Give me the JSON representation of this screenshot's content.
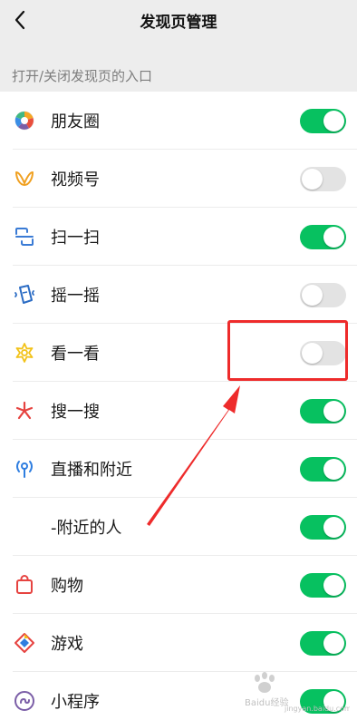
{
  "header": {
    "title": "发现页管理",
    "back_icon": "chevron-left-icon"
  },
  "section": {
    "label": "打开/关闭发现页的入口"
  },
  "colors": {
    "toggle_on": "#07c160",
    "toggle_off": "#e3e3e3",
    "annotation": "#ee2b2b"
  },
  "items": [
    {
      "label": "朋友圈",
      "icon": "moments-icon",
      "enabled": true
    },
    {
      "label": "视频号",
      "icon": "channels-icon",
      "enabled": false
    },
    {
      "label": "扫一扫",
      "icon": "scan-icon",
      "enabled": true
    },
    {
      "label": "摇一摇",
      "icon": "shake-icon",
      "enabled": false
    },
    {
      "label": "看一看",
      "icon": "top-stories-icon",
      "enabled": false
    },
    {
      "label": "搜一搜",
      "icon": "search-icon",
      "enabled": true
    },
    {
      "label": "直播和附近",
      "icon": "live-nearby-icon",
      "enabled": true
    },
    {
      "label": "-附近的人",
      "icon": "",
      "enabled": true
    },
    {
      "label": "购物",
      "icon": "shopping-bag-icon",
      "enabled": true
    },
    {
      "label": "游戏",
      "icon": "games-icon",
      "enabled": true
    },
    {
      "label": "小程序",
      "icon": "mini-programs-icon",
      "enabled": true
    }
  ],
  "watermark": {
    "brand": "Baidu经验",
    "url": "jingyan.baidu.com"
  }
}
